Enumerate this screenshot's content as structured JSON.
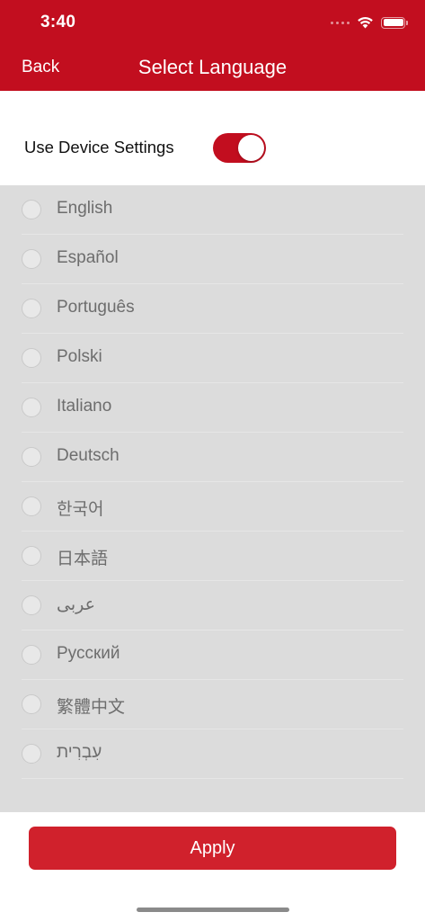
{
  "status_bar": {
    "time": "3:40"
  },
  "nav": {
    "back_label": "Back",
    "title": "Select Language"
  },
  "device_settings": {
    "label": "Use Device Settings",
    "enabled": true
  },
  "languages": [
    {
      "label": "English",
      "selected": false
    },
    {
      "label": "Español",
      "selected": false
    },
    {
      "label": "Português",
      "selected": false
    },
    {
      "label": "Polski",
      "selected": false
    },
    {
      "label": "Italiano",
      "selected": false
    },
    {
      "label": "Deutsch",
      "selected": false
    },
    {
      "label": "한국어",
      "selected": false
    },
    {
      "label": "日本語",
      "selected": false
    },
    {
      "label": "عربى",
      "selected": false
    },
    {
      "label": "Русский",
      "selected": false
    },
    {
      "label": "繁體中文",
      "selected": false
    },
    {
      "label": "עִבְרִית",
      "selected": false
    }
  ],
  "apply_label": "Apply",
  "colors": {
    "brand": "#c20e1f",
    "apply_button": "#d0212c",
    "list_background": "#dcdcdc"
  }
}
